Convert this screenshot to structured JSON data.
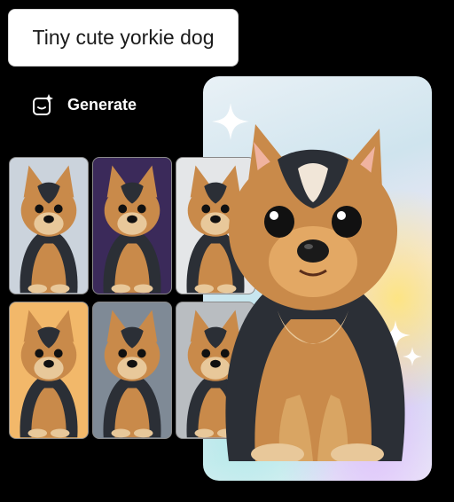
{
  "prompt": {
    "text": "Tiny cute yorkie dog"
  },
  "actions": {
    "generate_label": "Generate",
    "generate_icon": "sparkle-wand-icon"
  },
  "thumbnails": [
    {
      "name": "yorkie-variation-1",
      "bg": "#cbd3dc"
    },
    {
      "name": "yorkie-variation-2",
      "bg": "#3b2a5a"
    },
    {
      "name": "yorkie-variation-3",
      "bg": "#e4e6e8"
    },
    {
      "name": "yorkie-variation-4",
      "bg": "#f2b86a"
    },
    {
      "name": "yorkie-variation-5",
      "bg": "#7f8a96"
    },
    {
      "name": "yorkie-variation-6",
      "bg": "#b9bdc1"
    }
  ],
  "colors": {
    "tan": "#c98a4a",
    "dark_fur": "#2b2f36",
    "light_fur": "#e8c89a"
  }
}
